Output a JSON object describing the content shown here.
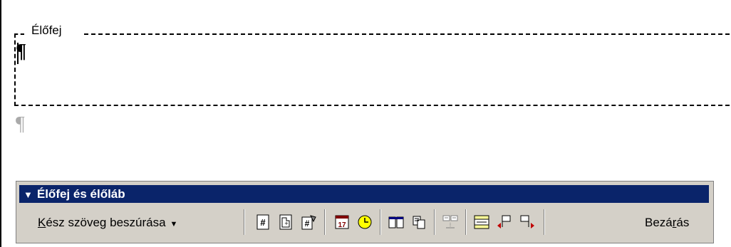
{
  "document": {
    "header_label": "Élőfej",
    "paragraph_mark": "¶"
  },
  "toolbar": {
    "title": "Élőfej és élőláb",
    "title_bar_color": "#0a246a",
    "autotext_label_prefix": "",
    "autotext_label_accel": "K",
    "autotext_label_rest": "ész szöveg beszúrása",
    "close_label_pre": "Bezá",
    "close_label_accel": "r",
    "close_label_post": "ás",
    "buttons": [
      {
        "name": "insert-page-number-icon"
      },
      {
        "name": "insert-number-of-pages-icon"
      },
      {
        "name": "format-page-number-icon"
      },
      {
        "name": "insert-date-icon"
      },
      {
        "name": "insert-time-icon"
      },
      {
        "name": "page-setup-icon"
      },
      {
        "name": "show-hide-document-text-icon"
      },
      {
        "name": "same-as-previous-icon"
      },
      {
        "name": "switch-header-footer-icon"
      },
      {
        "name": "show-previous-icon"
      },
      {
        "name": "show-next-icon"
      }
    ]
  }
}
